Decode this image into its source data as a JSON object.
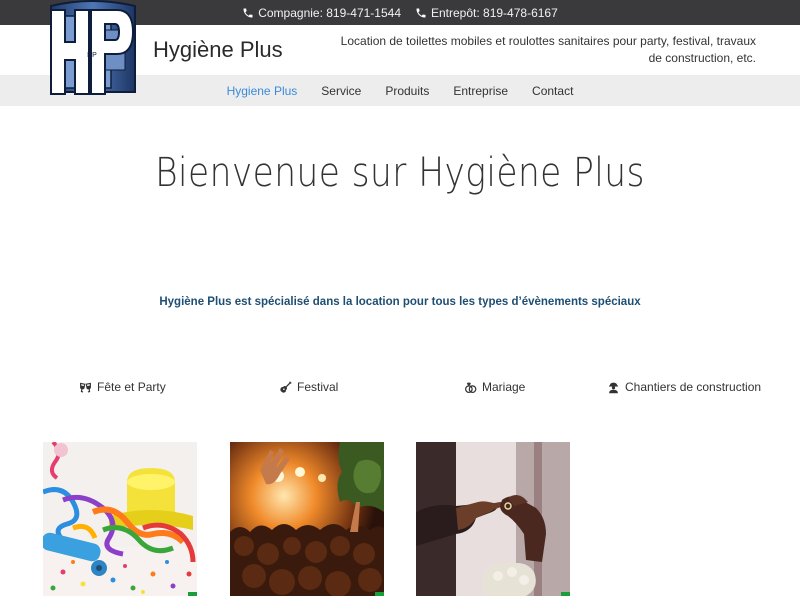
{
  "topbar": {
    "company_phone": "Compagnie: 819-471-1544",
    "warehouse_phone": "Entrepôt: 819-478-6167",
    "background_color": "#3a3a3c"
  },
  "header": {
    "logo_text": "HP",
    "site_title": "Hygiène Plus",
    "tagline": "Location de toilettes mobiles et roulottes sanitaires pour party, festival, travaux de construction, etc."
  },
  "nav": {
    "items": [
      {
        "label": "Hygiene Plus",
        "active": true
      },
      {
        "label": "Service",
        "active": false
      },
      {
        "label": "Produits",
        "active": false
      },
      {
        "label": "Entreprise",
        "active": false
      },
      {
        "label": "Contact",
        "active": false
      }
    ],
    "active_color": "#3b8ad8"
  },
  "main": {
    "title": "Bienvenue sur Hygiène Plus",
    "intro": "Hygiène Plus est spécialisé dans la location pour tous les types d’évènements spéciaux",
    "categories": [
      {
        "label": "Fête et Party",
        "icon": "glasses-cheers-icon"
      },
      {
        "label": "Festival",
        "icon": "guitar-icon"
      },
      {
        "label": "Mariage",
        "icon": "rings-icon"
      },
      {
        "label": "Chantiers de construction",
        "icon": "construction-worker-icon"
      }
    ],
    "intro_color": "#1e4e73"
  }
}
